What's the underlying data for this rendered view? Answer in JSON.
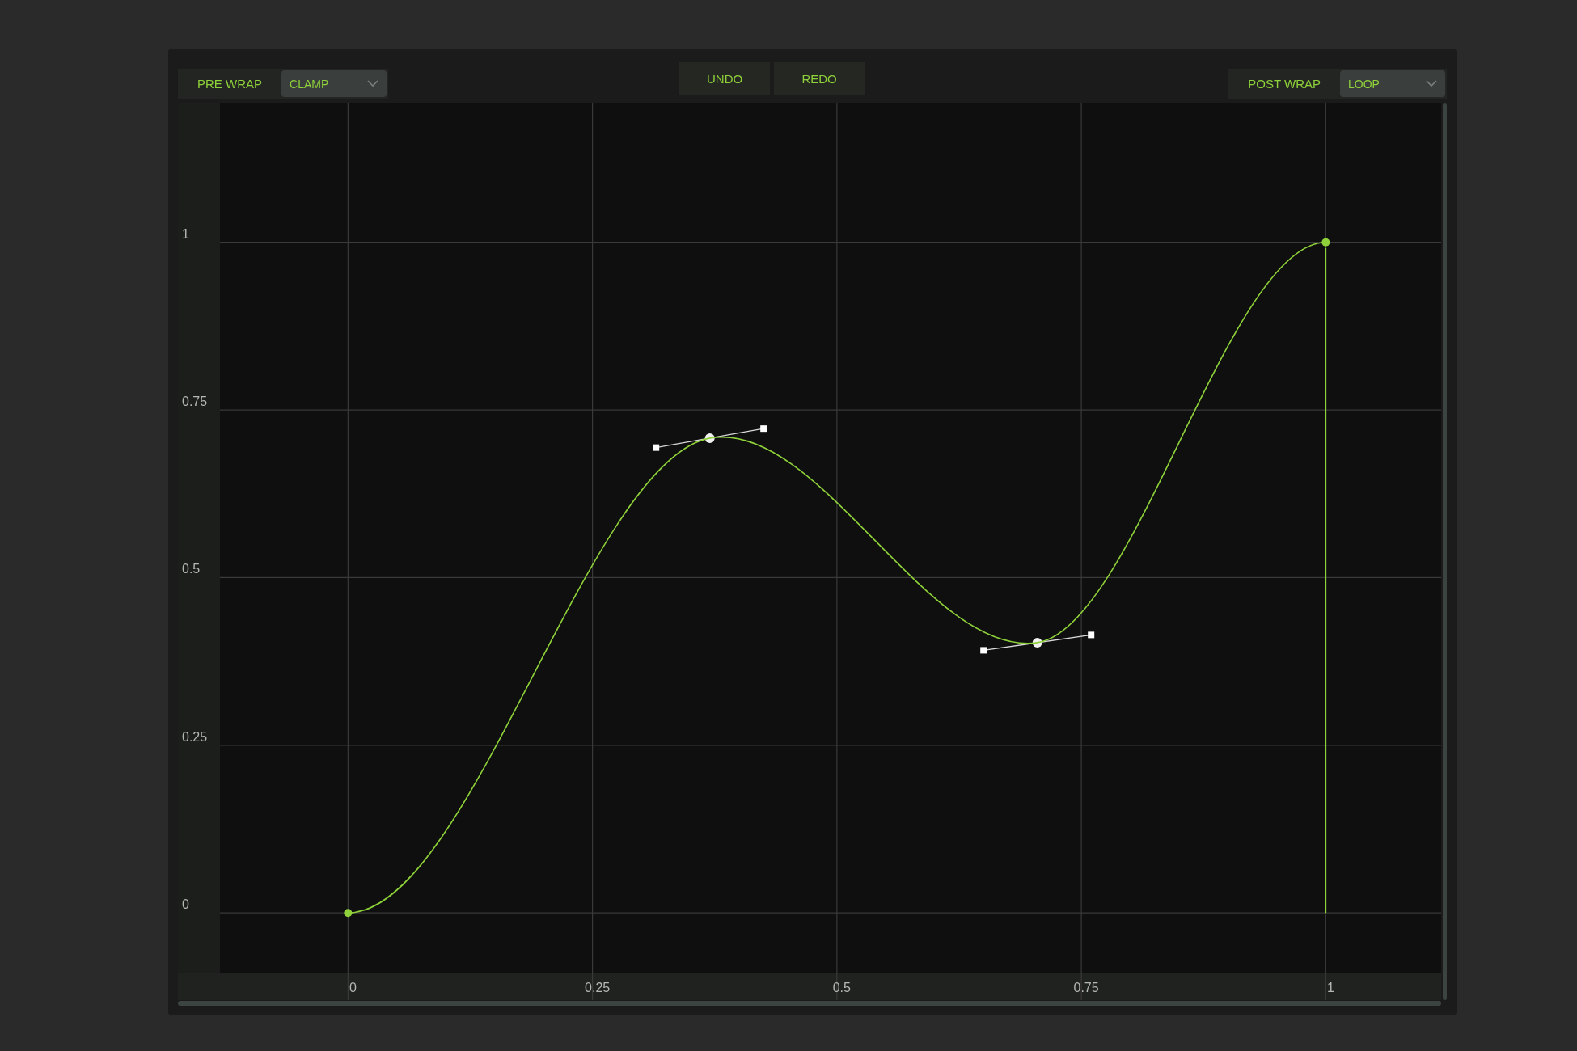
{
  "toolbar": {
    "pre_wrap": {
      "label": "PRE WRAP",
      "value": "CLAMP"
    },
    "buttons": [
      "UNDO",
      "REDO"
    ],
    "post_wrap": {
      "label": "POST WRAP",
      "value": "LOOP"
    }
  },
  "curve_editor": {
    "chart_data": {
      "type": "line",
      "x": [
        0,
        0.37,
        0.705,
        1
      ],
      "series": [
        {
          "color": "#8fd13a",
          "marker": "circle",
          "values": [
            0,
            0.708,
            0.403,
            1
          ]
        }
      ],
      "grid": true,
      "ref_lines": [
        {
          "axis": "x",
          "value": 1
        }
      ],
      "xlim": [
        -0.174,
        1.118
      ],
      "ylim": [
        -0.13,
        1.207
      ],
      "xticks": [
        0,
        0.25,
        0.5,
        0.75,
        1
      ],
      "yticks": [
        0,
        0.25,
        0.5,
        0.75,
        1
      ]
    },
    "keyframes": [
      {
        "selected": false
      },
      {
        "selected": true
      },
      {
        "selected": true
      },
      {
        "selected": false
      }
    ]
  }
}
